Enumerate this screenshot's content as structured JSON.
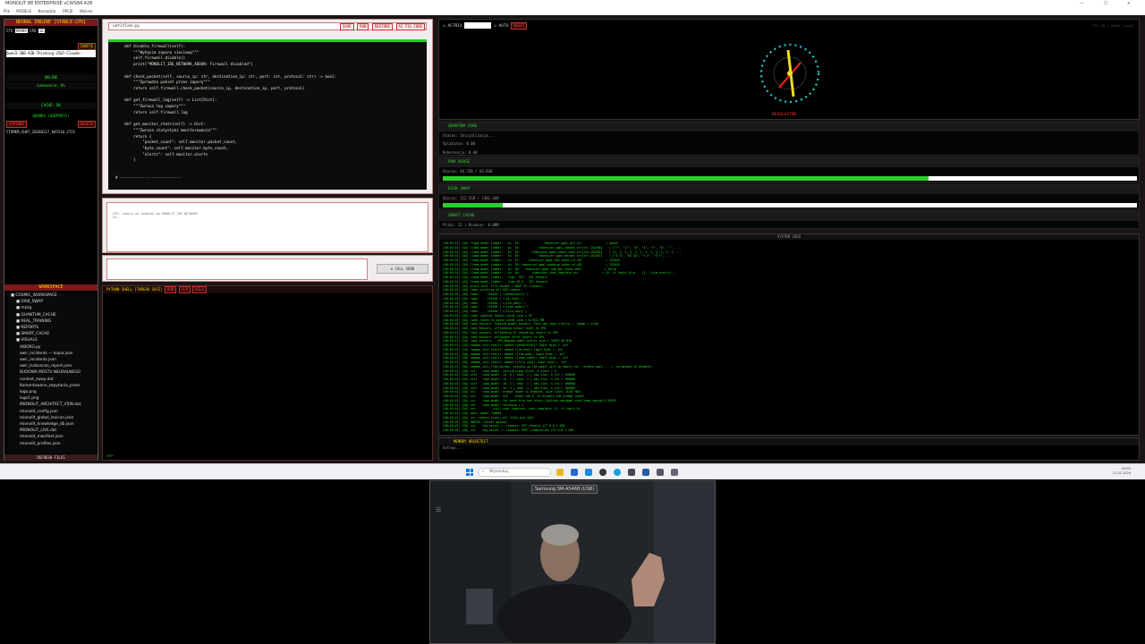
{
  "window": {
    "title": "MONOLIT 88 ENTERPRISE vCWS84.428",
    "menu": [
      "Plik",
      "MODELE",
      "Narzędzia",
      "OPCJE",
      "Wykres"
    ]
  },
  "sidebar": {
    "engine_header": "NEURAL ENGINE [STABLE-CPU]",
    "ctx_label": "CTX",
    "ctx_value": "99999",
    "cpu_label": "CPU",
    "cpu_value": "16",
    "ignite_label": "IGNITE",
    "model_name": "Qwen3-30B-A3B-Thinking-2507-Claude-",
    "status_online": "ONLINE",
    "loading_text": "Ładowanie: 0%",
    "cache_status": "CACHE: ON",
    "quarks_header": "QUARKS (SNIPPETS)",
    "capture_label": "CAPTURE",
    "delete_label": "DELETE",
    "snippet_item": "CTXMEM_CHAT_20260117_045516_2721",
    "workspace_header": "WORKSPACE",
    "tree": [
      "COSMIC_WORKSPACE",
      "DISK_SWAP",
      "mózg",
      "QUANTUM_CACHE",
      "REAL_TRAINING",
      "REPORTS",
      "SMART_CACHE",
      "VISUALS",
      "AIBORG.py",
      "awir_incidents — kopia.json",
      "awir_incidents.json",
      "awir_turboscan_report.json",
      "BUDOWA MOSTU NEURALNEGO",
      "contest_swap.dat",
      "Komentowane_zapytania_prom",
      "logo.png",
      "logo1.png",
      "MIONOLIT_ARCHITECT_V5IN.dat",
      "mionolit_config.json",
      "mionolit_global_lexicon.json",
      "mionolit_knowledge_db.json",
      "MIONOLIT_LIVE.dat",
      "mionolit_manifest.json",
      "mionolit_profiles.json"
    ],
    "refresh_label": "REFRESH FILES"
  },
  "editor": {
    "filename": "untitled.py",
    "buttons": [
      "SAVE",
      "RUN",
      "RESTORE",
      "AI FIX CODE"
    ],
    "code": "    def disable_firewall(self):\n        \"\"\"Wyłącza zaporę sieciową\"\"\"\n        self.firewall.disable()\n        print(\"MONOLIT_IDE_NETWORK_ADDON: Firewall disabled\")\n\n    def check_packet(self, source_ip: str, destination_ip: str, port: int, protocol: str) -> bool:\n        \"\"\"Sprawdza pakiet przez zaporę\"\"\"\n        return self.firewall.check_packet(source_ip, destination_ip, port, protocol)\n\n    def get_firewall_log(self) -> List[Dict]:\n        \"\"\"Zwraca log zapory\"\"\"\n        return self.firewall.log\n\n    def get_monitor_stats(self) -> Dict:\n        \"\"\"Zwraca statystyki monitorowania\"\"\"\n        return {\n            \"packet_count\": self.monitor.packet_count,\n            \"byte_count\": self.monitor.byte_count,\n            \"alerts\": self.monitor.alerts\n        }\n\n\n# ---------------------------"
  },
  "chat": {
    "response_text": "SYS: zapisz mi dodatek do MONOLIT_IDE_NETWORK\nAI:",
    "send_label": "CALL SEND"
  },
  "shell": {
    "title": "PYTHON SHELL [THREAD SAFE]",
    "buttons": [
      "RUN",
      "CLR",
      "KILL"
    ],
    "prompt": ">>>"
  },
  "toolbar": {
    "actrix_label": "ACTRIX",
    "auto_label": "AUTO",
    "reset_label": "RESET",
    "fps_info": "FPS: 60 | WARNS: 5a2a2"
  },
  "visual": {
    "caption": "REVOLVATOR"
  },
  "quantum": {
    "title": "QUANTUM CORE",
    "status": "Status: Inicjalizacja...",
    "splatanie": "Splątanie: 0.00",
    "koherencja": "Koherencja: 0.00"
  },
  "ram": {
    "title": "RAM USAGE",
    "usage": "Użycie: 44.7GB / 63.9GB",
    "fraction": 0.7
  },
  "disk": {
    "title": "DISK SWAP",
    "usage": "Użycie: 112.5GB / 1302.3GB",
    "fraction": 0.086
  },
  "smart_cache": {
    "title": "SMART CACHE",
    "info": "Pliki: 12 | Rozmiar: 0.0MB"
  },
  "logs": {
    "title": "SYSTEM LOGS",
    "text": "[00:48:34] [GA] llama_model_loader: - kv  33:              tokenizer.ggml.pre str              = qwen2\n[00:48:34] [GA] llama_model_loader: - kv  34:           tokenizer.ggml.tokens arr[str,151936]    = [\"!\", \"\\\"\", \"#\", \"$\", \"%\", \"&\", \"'\", ...\n[00:48:34] [GA] llama_model_loader: - kv  35:       tokenizer.ggml.token_type arr[i32,151936]    = [1, 1, 1, 1, 1, 1, 1, 1, 1, 1, 1, 1, ...\n[00:48:34] [GA] llama_model_loader: - kv  36:           tokenizer.ggml.merges arr[str,151387]    = [\"Ġ Ġ\", \"ĠĠ ĠĠ\", \"i n\", \"Ġ t\",...\n[00:48:34] [GA] llama_model_loader: - kv  37:     tokenizer.ggml.eos_token_id u32              = 151645\n[00:48:34] [GA] llama_model_loader: - kv  38: tokenizer.ggml.padding_token_id u32              = 151643\n[00:48:34] [GA] llama_model_loader: - kv  39:   tokenizer.ggml.add_bos_token bool             = false\n[00:48:34] [GA] llama_model_loader: - kv  40:       tokenizer.chat_template str              = {%- if tools %}\\n    {{- '<|im_start|>...\n[00:48:34] [GA] llama_model_loader: - type  f32:  241 tensors\n[00:48:34] [GA] llama_model_loader: - type q5_K:  337 tensors\n[00:48:35] [GA] print_info: file format = GGUF V3 (latest)\n[00:48:35] [GA] load: printing all EOG tokens:\n[00:48:35] [GA] load:   - 151643 ('<|endoftext|>')\n[00:48:35] [GA] load:   - 151645 ('<|im_end|>')\n[00:48:35] [GA] load:   - 151662 ('<|fim_pad|>')\n[00:48:35] [GA] load:   - 151663 ('<|repo_name|>')\n[00:48:35] [GA] load:   - 151664 ('<|file_sep|>')\n[00:48:35] [GA] load: special tokens cache size = 26\n[00:48:35] [GA] load: token to piece cache size = 0.9311 MB\n[00:48:36] [GA] load_tensors: loading model tensors, this can take a while... (mmap = true)\n[00:48:41] [GA] load_tensors: offloading output layer to GPU\n[00:48:41] [GA] load_tensors: offloading 47 repeating layers to GPU\n[00:48:41] [GA] load_tensors: offloaded 49/49 layers to GPU\n[00:48:41] [GA] load_tensors:   CPU_Mapped model buffer size = 20975.48 MiB\n[00:48:42] [GA] common_init_result: added <|endoftext|> logit bias = -inf\n[00:48:42] [GA] common_init_result: added <|im_end|> logit bias = -inf\n[00:48:42] [GA] common_init_result: added <|fim_pad|> logit bias = -inf\n[00:48:42] [GA] common_init_result: added <|repo_name|> logit bias = -inf\n[00:48:42] [GA] common_init_result: added <|file_sep|> logit bias = -inf\n[00:48:42] [GA] common_init_from_params: warming up the model with an empty run - please wait ... (--no-warmup to disable)\n[00:48:44] [GA] srv    load_model: initializing slots, n_slots = 4\n[00:48:44] [GA] slot   load_model: id  0 | task -1 | new slot, n_ctx = 100000\n[00:48:44] [GA] slot   load_model: id  1 | task -1 | new slot, n_ctx = 100000\n[00:48:44] [GA] slot   load_model: id  2 | task -1 | new slot, n_ctx = 100000\n[00:48:44] [GA] slot   load_model: id  3 | task -1 | new slot, n_ctx = 100000\n[00:48:44] [GA] srv    load_model: prompt cache is enabled, size limit: 8192 MiB\n[00:48:44] [GA] srv    load_model: use `--cache-ram 0` to disable the prompt cache\n[00:48:44] [GA] srv    load_model: for more info see https://github.com/ggml-org/llama.cpp/pull/16391\n[00:48:44] [GA] srv    load_model: thinking = 1\n[00:48:44] [GA] srv          init: chat template, chat_template: {%- if tools %}\n[00:48:44] [GA] main: model loaded\n[00:48:44] [GA] srv  update_slots: all slots are idle\n[00:48:45] [GA] SUKCES: Serwer gotowy!\n[00:48:45] [GA] srv    log_server_r: request: GET /health 127.0.0.1 200\n[00:48:46] [GA] srv    log_server_r: request: POST /completion 127.0.0.1 200"
  },
  "memory": {
    "title": "MEMORY ARCHITECT",
    "status": "Gotowy..."
  },
  "taskbar": {
    "search_placeholder": "Wyszukaj",
    "time": "04:55",
    "date": "17.01.2026"
  },
  "webcam": {
    "label": "Samsung SM-A546B (USB)"
  }
}
